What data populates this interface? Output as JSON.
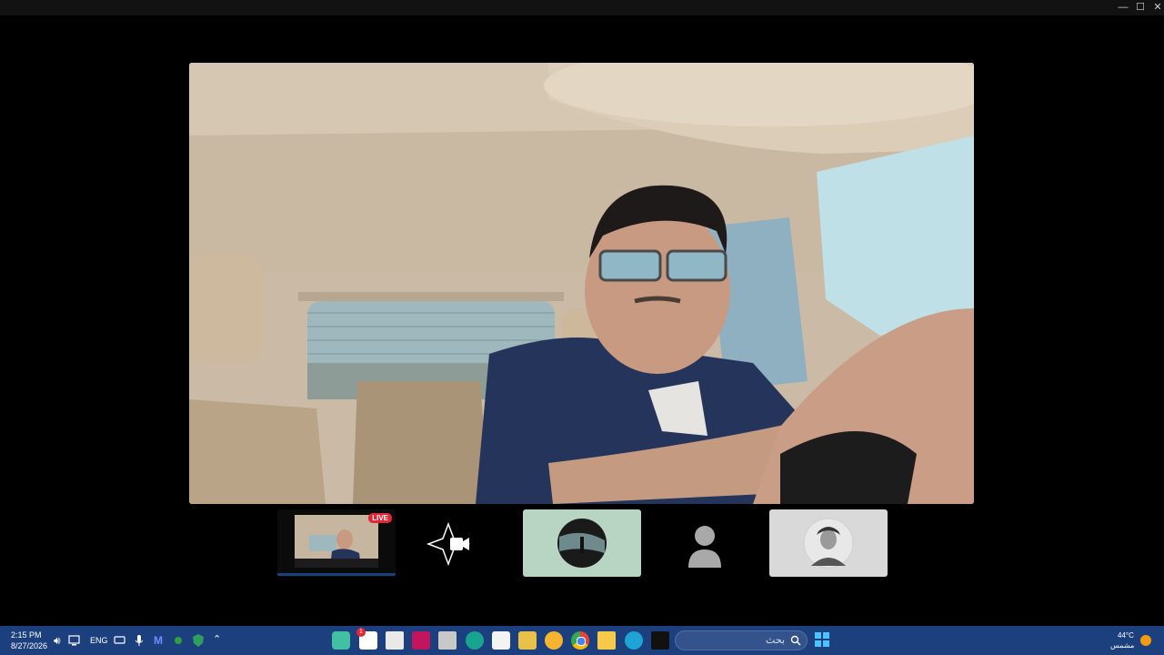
{
  "window": {
    "controls": {
      "minimize": "—",
      "maximize": "☐",
      "close": "✕"
    }
  },
  "main_video": {
    "description_icon": "video-feed"
  },
  "participants": {
    "live_badge": "LIVE",
    "tiles": [
      {
        "name": "self-preview"
      },
      {
        "name": "video-off"
      },
      {
        "name": "avatar-photo"
      },
      {
        "name": "default-avatar"
      },
      {
        "name": "portrait-avatar"
      }
    ]
  },
  "taskbar": {
    "time": "2:15 PM",
    "date": "8/27/2026",
    "language": "ENG",
    "search_placeholder": "بحث",
    "weather_temp": "44°C",
    "weather_desc": "مشمس",
    "notification_count": "1",
    "accent": "#1c3f7e"
  }
}
